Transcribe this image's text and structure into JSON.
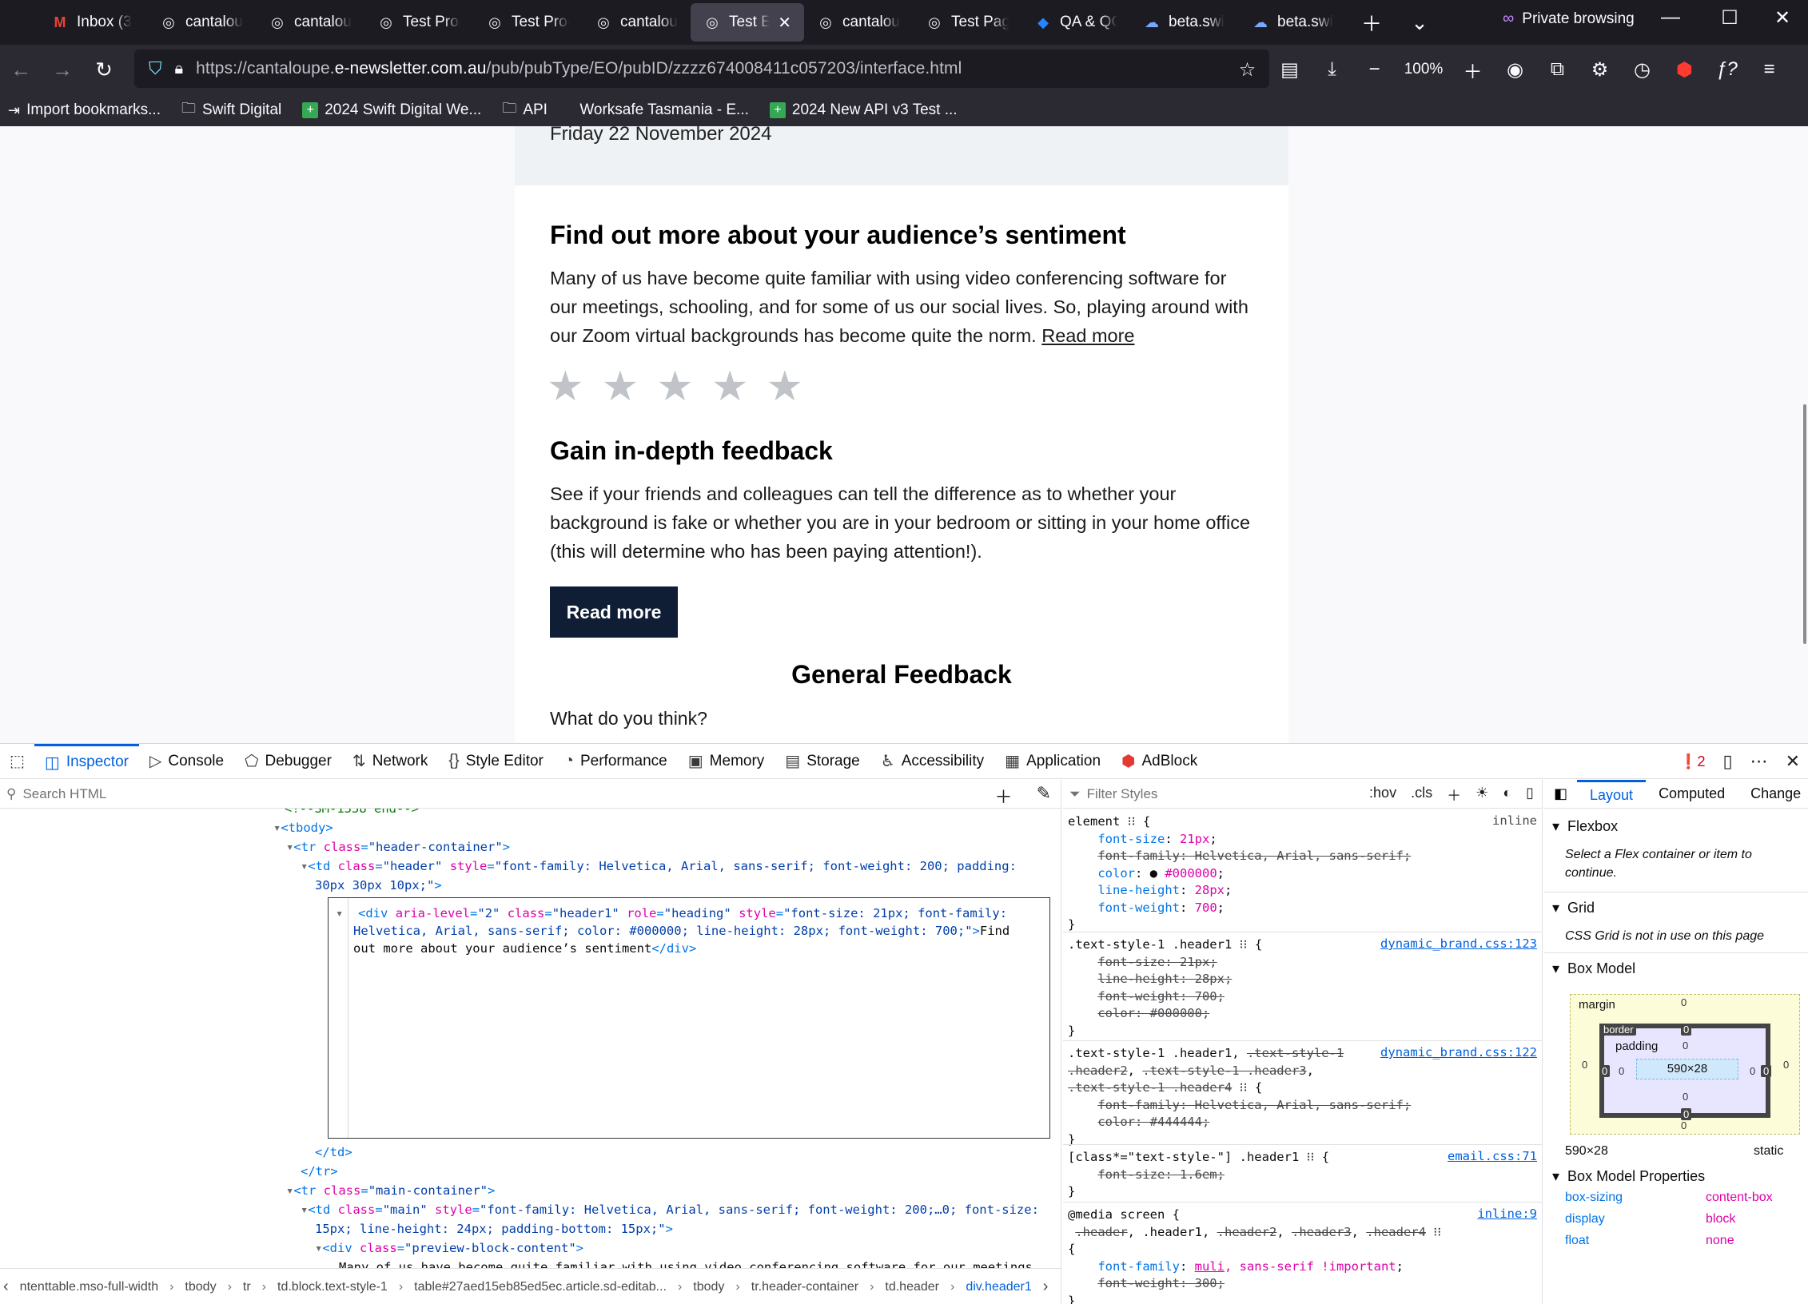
{
  "browser": {
    "tabs": [
      {
        "label": "Inbox (3",
        "icon": "gmail-icon"
      },
      {
        "label": "cantalou",
        "icon": "cantaloupe-icon"
      },
      {
        "label": "cantalou",
        "icon": "cantaloupe-icon"
      },
      {
        "label": "Test Proc",
        "icon": "cantaloupe-icon"
      },
      {
        "label": "Test Proc",
        "icon": "cantaloupe-icon"
      },
      {
        "label": "cantalou",
        "icon": "cantaloupe-icon"
      },
      {
        "label": "Test E",
        "icon": "cantaloupe-icon",
        "active": true
      },
      {
        "label": "cantalou",
        "icon": "cantaloupe-icon"
      },
      {
        "label": "Test Page",
        "icon": "cantaloupe-icon"
      },
      {
        "label": "QA & QC",
        "icon": "jira-icon"
      },
      {
        "label": "beta.swi",
        "icon": "confluence-icon"
      },
      {
        "label": "beta.swi",
        "icon": "confluence-icon"
      }
    ],
    "private_label": "Private browsing",
    "url_prefix": "https://cantaloupe.",
    "url_domain": "e-newsletter.com.au",
    "url_path": "/pub/pubType/EO/pubID/zzzz674008411c057203/interface.html",
    "zoom": "100%",
    "bookmarks": [
      "Import bookmarks...",
      "Swift Digital",
      "2024 Swift Digital We...",
      "API",
      "Worksafe Tasmania - E...",
      "2024 New API v3 Test ..."
    ]
  },
  "email": {
    "date": "Friday 22 November 2024",
    "heading1": "Find out more about your audience’s sentiment",
    "para1": "Many of us have become quite familiar with using video conferencing software for our meetings, schooling, and for some of us our social lives. So, playing around with our Zoom virtual backgrounds has become quite the norm.",
    "read_more_link": "Read more",
    "rating": 0,
    "rating_max": 5,
    "heading2": "Gain in-depth feedback",
    "para2": "See if your friends and colleagues can tell the difference as to whether your background is fake or whether you are in your bedroom or sitting in your home office (this will determine who has been paying attention!).",
    "button": "Read more",
    "heading3": "General Feedback",
    "question": "What do you think?"
  },
  "devtools": {
    "tabs": [
      "Inspector",
      "Console",
      "Debugger",
      "Network",
      "Style Editor",
      "Performance",
      "Memory",
      "Storage",
      "Accessibility",
      "Application",
      "AdBlock"
    ],
    "error_count": "2",
    "search_placeholder": "Search HTML",
    "filter_placeholder": "Filter Styles",
    "hov": ":hov",
    "cls": ".cls",
    "layout_tabs": [
      "Layout",
      "Computed",
      "Change"
    ],
    "breadcrumbs": [
      "ntenttable.mso-full-width",
      "tbody",
      "tr",
      "td.block.text-style-1",
      "table#27aed15eb85ed5ec.article.sd-editab...",
      "tbody",
      "tr.header-container",
      "td.header",
      "div.header1"
    ],
    "flexbox_title": "Flexbox",
    "flexbox_msg": "Select a Flex container or item to continue.",
    "grid_title": "Grid",
    "grid_msg": "CSS Grid is not in use on this page",
    "boxmodel_title": "Box Model",
    "box_size": "590×28",
    "box_position": "static",
    "bm_labels": {
      "margin": "margin",
      "border": "border",
      "padding": "padding",
      "zero": "0"
    },
    "props_title": "Box Model Properties",
    "props": [
      {
        "name": "box-sizing",
        "value": "content-box"
      },
      {
        "name": "display",
        "value": "block"
      },
      {
        "name": "float",
        "value": "none"
      }
    ]
  }
}
